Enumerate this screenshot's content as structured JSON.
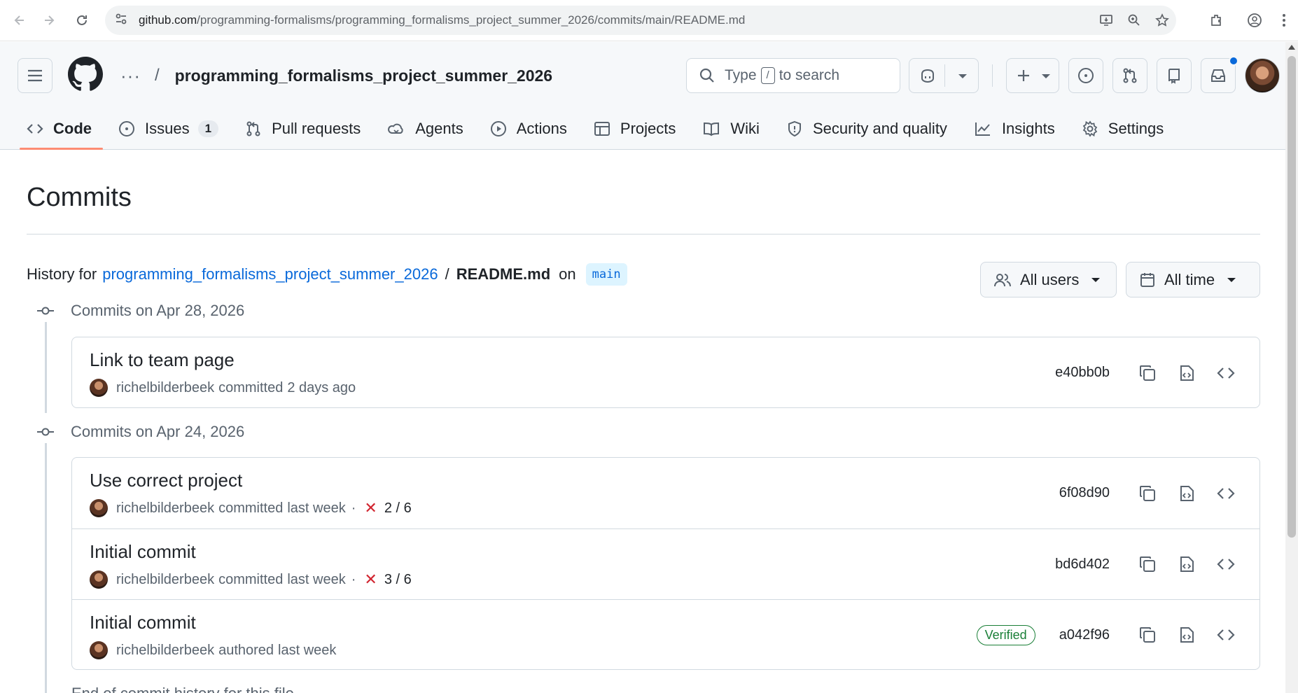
{
  "browser": {
    "url_host": "github.com",
    "url_path": "/programming-formalisms/programming_formalisms_project_summer_2026/commits/main/README.md"
  },
  "header": {
    "repo_name": "programming_formalisms_project_summer_2026",
    "search_prefix": "Type",
    "search_key": "/",
    "search_suffix": "to search"
  },
  "tabs": [
    {
      "label": "Code",
      "icon": "code-icon",
      "active": true
    },
    {
      "label": "Issues",
      "icon": "issue-icon",
      "count": "1"
    },
    {
      "label": "Pull requests",
      "icon": "pull-request-icon"
    },
    {
      "label": "Agents",
      "icon": "agents-icon"
    },
    {
      "label": "Actions",
      "icon": "play-icon"
    },
    {
      "label": "Projects",
      "icon": "table-icon"
    },
    {
      "label": "Wiki",
      "icon": "book-icon"
    },
    {
      "label": "Security and quality",
      "icon": "shield-icon"
    },
    {
      "label": "Insights",
      "icon": "graph-icon"
    },
    {
      "label": "Settings",
      "icon": "gear-icon"
    }
  ],
  "main": {
    "title": "Commits",
    "history_prefix": "History for",
    "history_repo": "programming_formalisms_project_summer_2026",
    "history_slash": "/",
    "history_file": "README.md",
    "history_on": "on",
    "branch": "main",
    "filter_users": "All users",
    "filter_time": "All time"
  },
  "groups": [
    {
      "heading": "Commits on Apr 28, 2026",
      "commits": [
        {
          "message": "Link to team page",
          "author": "richelbilderbeek",
          "action": "committed",
          "when": "2 days ago",
          "sha": "e40bb0b"
        }
      ]
    },
    {
      "heading": "Commits on Apr 24, 2026",
      "commits": [
        {
          "message": "Use correct project",
          "author": "richelbilderbeek",
          "action": "committed",
          "when": "last week",
          "checks": "2 / 6",
          "sha": "6f08d90"
        },
        {
          "message": "Initial commit",
          "author": "richelbilderbeek",
          "action": "committed",
          "when": "last week",
          "checks": "3 / 6",
          "sha": "bd6d402"
        },
        {
          "message": "Initial commit",
          "author": "richelbilderbeek",
          "action": "authored",
          "when": "last week",
          "badge": "Verified",
          "sha": "a042f96"
        }
      ]
    }
  ],
  "footer": "End of commit history for this file",
  "colors": {
    "accent": "#0969da",
    "tab_underline": "#fd8c73",
    "fail": "#d1242f",
    "verified": "#1a7f37"
  }
}
